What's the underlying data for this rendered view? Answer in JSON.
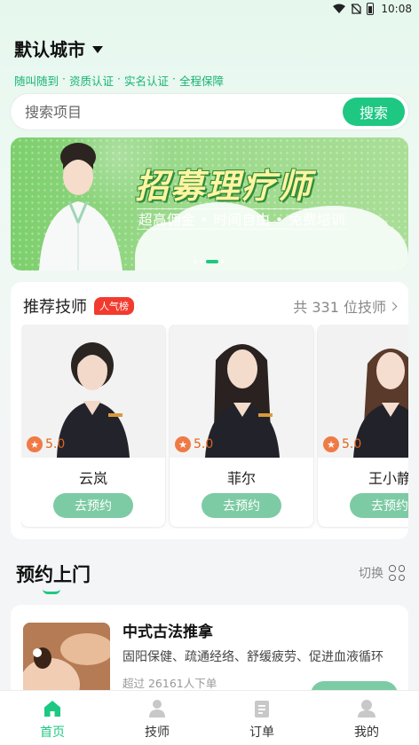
{
  "status_bar": {
    "time": "10:08"
  },
  "header": {
    "city": "默认城市",
    "features": [
      "随叫随到",
      "资质认证",
      "实名认证",
      "全程保障"
    ],
    "feature_separator": "·"
  },
  "search": {
    "placeholder": "搜索项目",
    "button": "搜索"
  },
  "banner": {
    "title": "招募理疗师",
    "subtitle": "超高佣金 • 时间自由 • 免费培训"
  },
  "recommend": {
    "title": "推荐技师",
    "badge": "人气榜",
    "count": "共 331 位技师",
    "technicians": [
      {
        "name": "云岚",
        "rating": "5.0",
        "button": "去预约"
      },
      {
        "name": "菲尔",
        "rating": "5.0",
        "button": "去预约"
      },
      {
        "name": "王小静",
        "rating": "5.0",
        "button": "去预约"
      }
    ]
  },
  "section": {
    "title": "预约上门",
    "switch": "切换"
  },
  "service": {
    "name": "中式古法推拿",
    "desc": "固阳保健、疏通经络、舒缓疲劳、促进血液循环",
    "orders": "超过 26161人下单"
  },
  "tabbar": [
    {
      "label": "首页",
      "icon": "home-icon",
      "active": true
    },
    {
      "label": "技师",
      "icon": "technician-icon",
      "active": false
    },
    {
      "label": "订单",
      "icon": "order-icon",
      "active": false
    },
    {
      "label": "我的",
      "icon": "profile-icon",
      "active": false
    }
  ],
  "colors": {
    "accent": "#1ec882",
    "badge": "#f23b2e",
    "button_soft": "#7dcba4"
  }
}
